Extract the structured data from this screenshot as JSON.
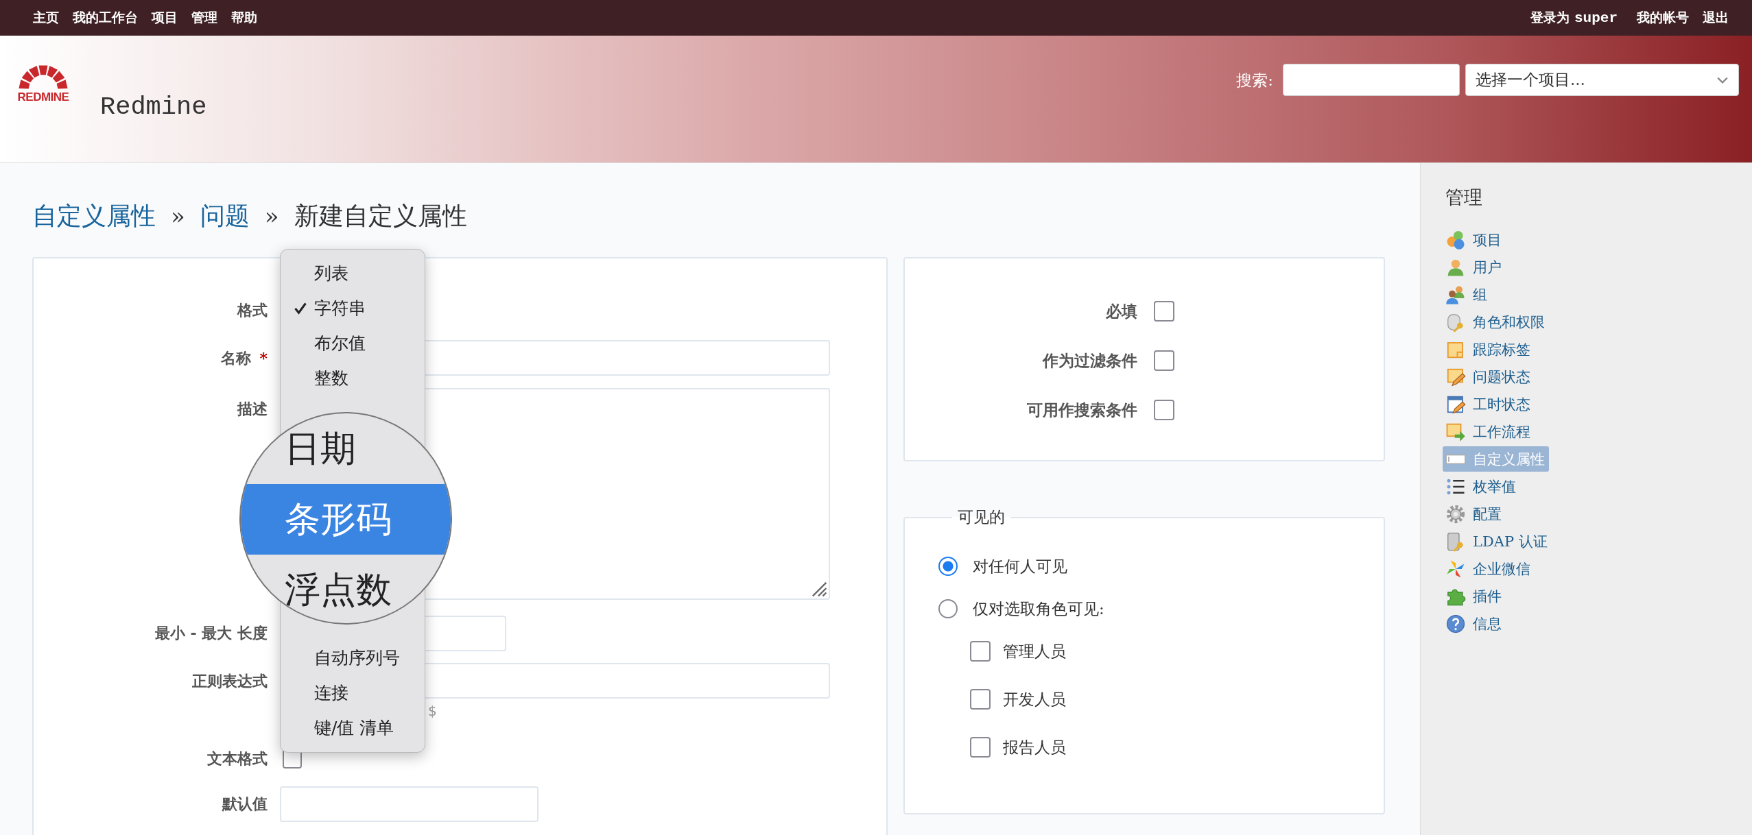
{
  "top_menu": [
    "主页",
    "我的工作台",
    "项目",
    "管理",
    "帮助"
  ],
  "account": {
    "logged_as": "登录为",
    "user": "super",
    "links": [
      "我的帐号",
      "退出"
    ]
  },
  "header": {
    "logo_wordmark": "REDMINE",
    "title": "Redmine",
    "search_label": "搜索:",
    "project_select": "选择一个项目..."
  },
  "breadcrumb": [
    {
      "kind": "link",
      "label": "自定义属性"
    },
    {
      "kind": "separator",
      "label": "»"
    },
    {
      "kind": "link",
      "label": "问题"
    },
    {
      "kind": "separator",
      "label": "»"
    },
    {
      "kind": "current",
      "label": "新建自定义属性"
    }
  ],
  "form": {
    "fields": [
      {
        "kind": "select",
        "label": "格式"
      },
      {
        "kind": "text",
        "label": "名称",
        "required_mark": "*"
      },
      {
        "kind": "textarea",
        "label": "描述"
      },
      {
        "kind": "short_text",
        "label": "最小 - 最大 长度"
      },
      {
        "kind": "text",
        "label": "正则表达式",
        "hint": "$"
      },
      {
        "kind": "checkbox",
        "label": "文本格式",
        "checked": false
      },
      {
        "kind": "medium_text",
        "label": "默认值"
      }
    ]
  },
  "format_menu": {
    "options_above": [
      {
        "label": "列表",
        "selected": false
      },
      {
        "label": "字符串",
        "selected": true
      },
      {
        "label": "布尔值",
        "selected": false
      },
      {
        "label": "整数",
        "selected": false
      }
    ],
    "options_below": [
      {
        "label": "自动序列号",
        "selected": false
      },
      {
        "label": "连接",
        "selected": false
      },
      {
        "label": "键/值 清单",
        "selected": false
      }
    ]
  },
  "magnifier": {
    "items": [
      {
        "label": "日期",
        "highlighted": false
      },
      {
        "label": "条形码",
        "highlighted": true
      },
      {
        "label": "浮点数",
        "highlighted": false
      }
    ]
  },
  "options": [
    {
      "label": "必填",
      "checked": false
    },
    {
      "label": "作为过滤条件",
      "checked": false
    },
    {
      "label": "可用作搜索条件",
      "checked": false
    }
  ],
  "visibility": {
    "legend": "可见的",
    "choices": [
      {
        "label": "对任何人可见",
        "selected": true
      },
      {
        "label": "仅对选取角色可见:",
        "selected": false
      }
    ],
    "roles": [
      {
        "label": "管理人员",
        "checked": false
      },
      {
        "label": "开发人员",
        "checked": false
      },
      {
        "label": "报告人员",
        "checked": false
      }
    ]
  },
  "sidebar": {
    "title": "管理",
    "items": [
      {
        "label": "项目",
        "selected": false
      },
      {
        "label": "用户",
        "selected": false
      },
      {
        "label": "组",
        "selected": false
      },
      {
        "label": "角色和权限",
        "selected": false
      },
      {
        "label": "跟踪标签",
        "selected": false
      },
      {
        "label": "问题状态",
        "selected": false
      },
      {
        "label": "工时状态",
        "selected": false
      },
      {
        "label": "工作流程",
        "selected": false
      },
      {
        "label": "自定义属性",
        "selected": true
      },
      {
        "label": "枚举值",
        "selected": false
      },
      {
        "label": "配置",
        "selected": false
      },
      {
        "label": "LDAP 认证",
        "selected": false
      },
      {
        "label": "企业微信",
        "selected": false
      },
      {
        "label": "插件",
        "selected": false
      },
      {
        "label": "信息",
        "selected": false
      }
    ]
  }
}
